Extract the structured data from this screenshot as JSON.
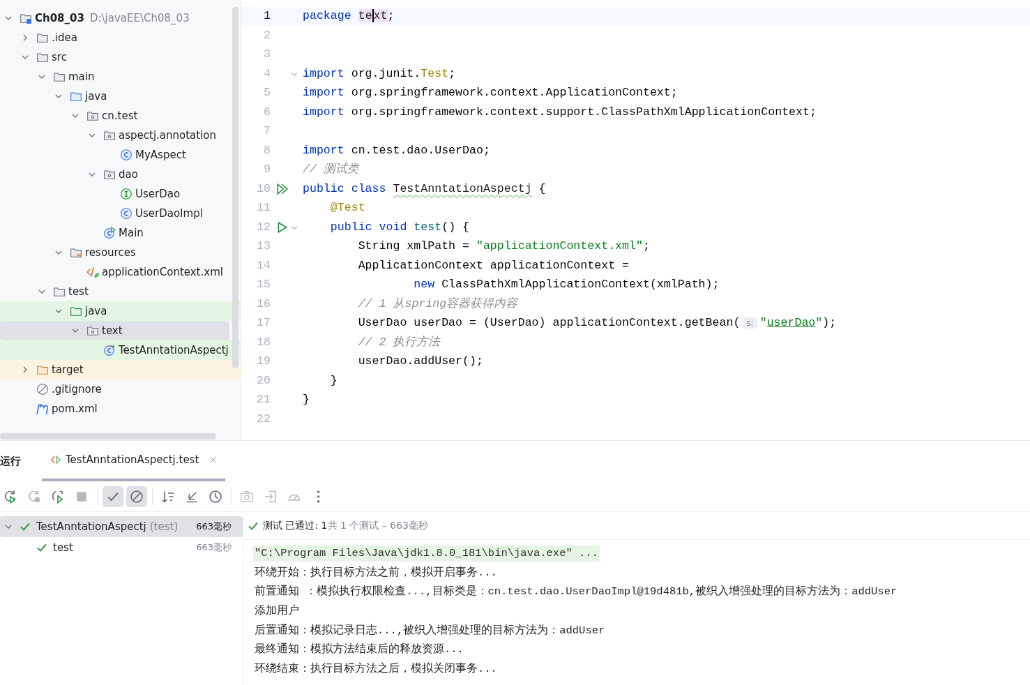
{
  "project_tree": {
    "items": [
      {
        "kind": "module",
        "name": "Ch08_03",
        "path": "D:\\javaEE\\Ch08_03",
        "expanded": true,
        "selected": false,
        "children": [
          {
            "kind": "folder",
            "name": ".idea",
            "expanded": false,
            "selected": false
          },
          {
            "kind": "folder",
            "name": "src",
            "expanded": true,
            "selected": false,
            "children": [
              {
                "kind": "folder",
                "name": "main",
                "expanded": true,
                "selected": false,
                "children": [
                  {
                    "kind": "source-folder",
                    "name": "java",
                    "expanded": true,
                    "selected": false,
                    "children": [
                      {
                        "kind": "package",
                        "name": "cn.test",
                        "expanded": true,
                        "selected": false,
                        "children": [
                          {
                            "kind": "package",
                            "name": "aspectj.annotation",
                            "expanded": true,
                            "selected": false,
                            "children": [
                              {
                                "kind": "class",
                                "name": "MyAspect",
                                "selected": false
                              }
                            ]
                          },
                          {
                            "kind": "package",
                            "name": "dao",
                            "expanded": true,
                            "selected": false,
                            "children": [
                              {
                                "kind": "interface",
                                "name": "UserDao",
                                "selected": false
                              },
                              {
                                "kind": "class",
                                "name": "UserDaoImpl",
                                "selected": false
                              }
                            ]
                          },
                          {
                            "kind": "main-class",
                            "name": "Main",
                            "selected": false
                          }
                        ]
                      }
                    ]
                  },
                  {
                    "kind": "resource-folder",
                    "name": "resources",
                    "expanded": true,
                    "selected": false,
                    "children": [
                      {
                        "kind": "xml",
                        "name": "applicationContext.xml",
                        "selected": false
                      }
                    ]
                  }
                ]
              },
              {
                "kind": "folder",
                "name": "test",
                "expanded": true,
                "selected": false,
                "children": [
                  {
                    "kind": "test-folder",
                    "name": "java",
                    "expanded": true,
                    "selected": false,
                    "children": [
                      {
                        "kind": "package",
                        "name": "text",
                        "expanded": true,
                        "selected": true,
                        "children": [
                          {
                            "kind": "test-class",
                            "name": "TestAnntationAspectj",
                            "selected": false
                          }
                        ]
                      }
                    ]
                  }
                ]
              }
            ]
          },
          {
            "kind": "excluded-folder",
            "name": "target",
            "expanded": false,
            "selected": false
          },
          {
            "kind": "ignore-file",
            "name": ".gitignore",
            "selected": false
          },
          {
            "kind": "maven",
            "name": "pom.xml",
            "selected": false
          }
        ]
      }
    ]
  },
  "editor": {
    "lines": [
      {
        "number": "1",
        "current": true,
        "tokens": [
          {
            "kind": "kw",
            "text": "package "
          },
          {
            "kind": "ident-hl",
            "text": "te"
          },
          {
            "kind": "caret",
            "text": "xt"
          },
          {
            "kind": "plain",
            "text": ";"
          }
        ]
      },
      {
        "number": "2"
      },
      {
        "number": "3"
      },
      {
        "number": "4",
        "fold": true,
        "tokens": [
          {
            "kind": "kw",
            "text": "import"
          },
          {
            "kind": "plain",
            "text": " org.junit."
          },
          {
            "kind": "ann",
            "text": "Test"
          },
          {
            "kind": "plain",
            "text": ";"
          }
        ]
      },
      {
        "number": "5",
        "tokens": [
          {
            "kind": "kw",
            "text": "import"
          },
          {
            "kind": "plain",
            "text": " org.springframework.context.ApplicationContext;"
          }
        ]
      },
      {
        "number": "6",
        "tokens": [
          {
            "kind": "kw",
            "text": "import"
          },
          {
            "kind": "plain",
            "text": " org.springframework.context.support.ClassPathXmlApplicationContext;"
          }
        ]
      },
      {
        "number": "7"
      },
      {
        "number": "8",
        "tokens": [
          {
            "kind": "kw",
            "text": "import"
          },
          {
            "kind": "plain",
            "text": " cn.test.dao.UserDao;"
          }
        ]
      },
      {
        "number": "9",
        "tokens": [
          {
            "kind": "comment",
            "text": "// 测试类"
          }
        ]
      },
      {
        "number": "10",
        "run_all": true,
        "tokens": [
          {
            "kind": "kw",
            "text": "public class "
          },
          {
            "kind": "typo",
            "text": "TestAnntationAspectj"
          },
          {
            "kind": "plain",
            "text": " {"
          }
        ]
      },
      {
        "number": "11",
        "tokens": [
          {
            "kind": "ann",
            "text": "    @Test"
          }
        ]
      },
      {
        "number": "12",
        "run": true,
        "fold": true,
        "tokens": [
          {
            "kind": "kw",
            "text": "    public void "
          },
          {
            "kind": "decl",
            "text": "test"
          },
          {
            "kind": "plain",
            "text": "() {"
          }
        ]
      },
      {
        "number": "13",
        "tokens": [
          {
            "kind": "plain",
            "text": "        String xmlPath = "
          },
          {
            "kind": "str",
            "text": "\"applicationContext.xml\""
          },
          {
            "kind": "plain",
            "text": ";"
          }
        ]
      },
      {
        "number": "14",
        "tokens": [
          {
            "kind": "plain",
            "text": "        ApplicationContext applicationContext ="
          }
        ]
      },
      {
        "number": "15",
        "tokens": [
          {
            "kind": "kw",
            "text": "                new"
          },
          {
            "kind": "plain",
            "text": " ClassPathXmlApplicationContext(xmlPath);"
          }
        ]
      },
      {
        "number": "16",
        "tokens": [
          {
            "kind": "comment",
            "text": "        // 1 从spring容器获得内容"
          }
        ]
      },
      {
        "number": "17",
        "tokens": [
          {
            "kind": "plain",
            "text": "        UserDao userDao = (UserDao) applicationContext.getBean("
          },
          {
            "kind": "hint",
            "text": "s:"
          },
          {
            "kind": "str",
            "text": "\""
          },
          {
            "kind": "link",
            "text": "userDao"
          },
          {
            "kind": "str",
            "text": "\""
          },
          {
            "kind": "plain",
            "text": ");"
          }
        ]
      },
      {
        "number": "18",
        "tokens": [
          {
            "kind": "comment",
            "text": "        // 2 执行方法"
          }
        ]
      },
      {
        "number": "19",
        "tokens": [
          {
            "kind": "plain",
            "text": "        userDao.addUser();"
          }
        ]
      },
      {
        "number": "20",
        "tokens": [
          {
            "kind": "plain",
            "text": "    }"
          }
        ]
      },
      {
        "number": "21",
        "tokens": [
          {
            "kind": "plain",
            "text": "}"
          }
        ]
      },
      {
        "number": "22"
      }
    ]
  },
  "run_panel": {
    "label": "运行",
    "tabs": [
      {
        "title": "TestAnntationAspectj.test",
        "selected": true
      }
    ],
    "toolbar": [
      {
        "kind": "rerun",
        "on": false,
        "disabled": false
      },
      {
        "kind": "rerun-failed",
        "on": false,
        "disabled": true
      },
      {
        "kind": "toggle-rerun",
        "on": false,
        "disabled": false
      },
      {
        "kind": "stop",
        "on": false,
        "disabled": true
      },
      {
        "kind": "separator"
      },
      {
        "kind": "show-passed",
        "on": true,
        "disabled": false
      },
      {
        "kind": "show-ignored",
        "on": true,
        "disabled": false
      },
      {
        "kind": "separator"
      },
      {
        "kind": "sort",
        "on": false,
        "disabled": false
      },
      {
        "kind": "collapse",
        "on": false,
        "disabled": false
      },
      {
        "kind": "history",
        "on": false,
        "disabled": false
      },
      {
        "kind": "separator"
      },
      {
        "kind": "camera",
        "on": false,
        "disabled": true
      },
      {
        "kind": "import",
        "on": false,
        "disabled": true
      },
      {
        "kind": "gauge",
        "on": false,
        "disabled": true
      },
      {
        "kind": "more",
        "on": false,
        "disabled": false
      }
    ],
    "tests": [
      {
        "name": "TestAnntationAspectj",
        "scope": "(test)",
        "time": "663毫秒",
        "expanded": true,
        "selected": true,
        "passed": true,
        "children": [
          {
            "name": "test",
            "time": "663毫秒",
            "selected": false,
            "passed": true
          }
        ]
      }
    ],
    "status": {
      "passed": "测试 已通过: 1",
      "total": "共 1 个测试 – 663毫秒"
    },
    "console": [
      {
        "kind": "command",
        "text": "\"C:\\Program Files\\Java\\jdk1.8.0_181\\bin\\java.exe\" ..."
      },
      {
        "kind": "output",
        "text": "环绕开始：执行目标方法之前，模拟开启事务..."
      },
      {
        "kind": "output",
        "text": "前置通知 ：模拟执行权限检查...,目标类是：cn.test.dao.UserDaoImpl@19d481b,被织入增强处理的目标方法为：addUser"
      },
      {
        "kind": "output",
        "text": "添加用户"
      },
      {
        "kind": "output",
        "text": "后置通知：模拟记录日志...,被织入增强处理的目标方法为：addUser"
      },
      {
        "kind": "output",
        "text": "最终通知：模拟方法结束后的释放资源..."
      },
      {
        "kind": "output",
        "text": "环绕结束：执行目标方法之后，模拟关闭事务..."
      }
    ]
  }
}
